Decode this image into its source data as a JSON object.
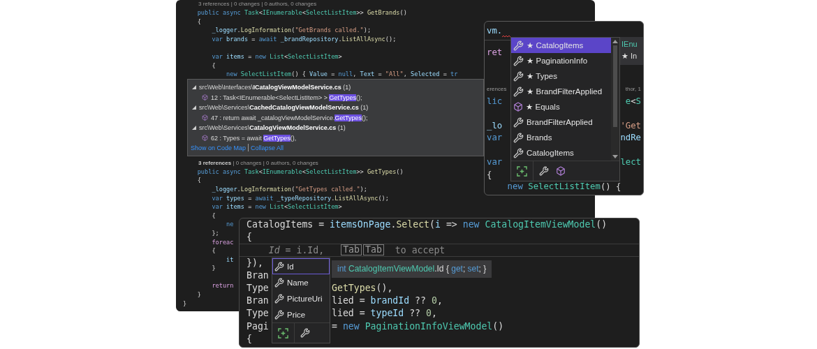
{
  "main_editor": {
    "lines": [
      {
        "kind": "codelens",
        "text": "3 references | 0 changes | 0 authors, 0 changes"
      },
      {
        "kind": "code",
        "tokens": [
          {
            "text": "    public async ",
            "kind": "kw"
          },
          {
            "text": "Task",
            "kind": "type"
          },
          {
            "text": "<",
            "kind": "plain"
          },
          {
            "text": "IEnumerable",
            "kind": "type"
          },
          {
            "text": "<",
            "kind": "plain"
          },
          {
            "text": "SelectListItem",
            "kind": "type"
          },
          {
            "text": ">> ",
            "kind": "plain"
          },
          {
            "text": "GetBrands",
            "kind": "method"
          },
          {
            "text": "()",
            "kind": "plain"
          }
        ]
      },
      {
        "kind": "code",
        "tokens": [
          {
            "text": "    {",
            "kind": "plain"
          }
        ]
      },
      {
        "kind": "code",
        "tokens": [
          {
            "text": "        _logger",
            "kind": "var"
          },
          {
            "text": ".",
            "kind": "plain"
          },
          {
            "text": "LogInformation",
            "kind": "method"
          },
          {
            "text": "(",
            "kind": "plain"
          },
          {
            "text": "\"GetBrands called.\"",
            "kind": "str"
          },
          {
            "text": ");",
            "kind": "plain"
          }
        ]
      },
      {
        "kind": "code",
        "tokens": [
          {
            "text": "        var ",
            "kind": "kw"
          },
          {
            "text": "brands",
            "kind": "var"
          },
          {
            "text": " = ",
            "kind": "plain"
          },
          {
            "text": "await ",
            "kind": "kw"
          },
          {
            "text": "_brandRepository",
            "kind": "var"
          },
          {
            "text": ".",
            "kind": "plain"
          },
          {
            "text": "ListAllAsync",
            "kind": "method"
          },
          {
            "text": "();",
            "kind": "plain"
          }
        ]
      },
      {
        "kind": "blank"
      },
      {
        "kind": "code",
        "tokens": [
          {
            "text": "        var ",
            "kind": "kw"
          },
          {
            "text": "items",
            "kind": "var"
          },
          {
            "text": " = ",
            "kind": "plain"
          },
          {
            "text": "new ",
            "kind": "kw"
          },
          {
            "text": "List",
            "kind": "type"
          },
          {
            "text": "<",
            "kind": "plain"
          },
          {
            "text": "SelectListItem",
            "kind": "type"
          },
          {
            "text": ">",
            "kind": "plain"
          }
        ]
      },
      {
        "kind": "code",
        "tokens": [
          {
            "text": "        {",
            "kind": "plain"
          }
        ]
      },
      {
        "kind": "code",
        "tokens": [
          {
            "text": "            new ",
            "kind": "kw"
          },
          {
            "text": "SelectListItem",
            "kind": "type"
          },
          {
            "text": "() { ",
            "kind": "plain"
          },
          {
            "text": "Value",
            "kind": "var"
          },
          {
            "text": " = ",
            "kind": "plain"
          },
          {
            "text": "null",
            "kind": "kw"
          },
          {
            "text": ", ",
            "kind": "plain"
          },
          {
            "text": "Text",
            "kind": "var"
          },
          {
            "text": " = ",
            "kind": "plain"
          },
          {
            "text": "\"All\"",
            "kind": "str"
          },
          {
            "text": ", ",
            "kind": "plain"
          },
          {
            "text": "Selected",
            "kind": "var"
          },
          {
            "text": " = ",
            "kind": "plain"
          },
          {
            "text": "tr",
            "kind": "kw"
          }
        ]
      },
      {
        "kind": "references_popup",
        "rows": [
          {
            "kind": "file",
            "folder": "src\\Web\\Interfaces\\",
            "file": "ICatalogViewModelService.cs",
            "count": "(1)",
            "expanded": true
          },
          {
            "kind": "reference",
            "before": "12 : Task<IEnumerable<SelectListItem> > ",
            "match": "GetTypes",
            "after": "();"
          },
          {
            "kind": "file",
            "folder": "src\\Web\\Services\\",
            "file": "CachedCatalogViewModelService.cs",
            "count": "(1)",
            "expanded": true
          },
          {
            "kind": "reference",
            "before": "47 : return await _catalogViewModelService.",
            "match": "GetTypes",
            "after": "();"
          },
          {
            "kind": "file",
            "folder": "src\\Web\\Services\\",
            "file": "CatalogViewModelService.cs",
            "count": "(1)",
            "expanded": true
          },
          {
            "kind": "reference",
            "before": "62 : Types = await ",
            "match": "GetTypes",
            "after": "(),"
          }
        ],
        "links": [
          "Show on Code Map",
          "Collapse All"
        ]
      },
      {
        "kind": "codelens",
        "text": "**3 references** | 0 changes | 0 authors, 0 changes"
      },
      {
        "kind": "code",
        "tokens": [
          {
            "text": "    public async ",
            "kind": "kw"
          },
          {
            "text": "Task",
            "kind": "type"
          },
          {
            "text": "<",
            "kind": "plain"
          },
          {
            "text": "IEnumerable",
            "kind": "type"
          },
          {
            "text": "<",
            "kind": "plain"
          },
          {
            "text": "SelectListItem",
            "kind": "type"
          },
          {
            "text": ">> ",
            "kind": "plain"
          },
          {
            "text": "GetTypes",
            "kind": "method"
          },
          {
            "text": "()",
            "kind": "plain"
          }
        ]
      },
      {
        "kind": "code",
        "tokens": [
          {
            "text": "    {",
            "kind": "plain"
          }
        ]
      },
      {
        "kind": "code",
        "tokens": [
          {
            "text": "        _logger",
            "kind": "var"
          },
          {
            "text": ".",
            "kind": "plain"
          },
          {
            "text": "LogInformation",
            "kind": "method"
          },
          {
            "text": "(",
            "kind": "plain"
          },
          {
            "text": "\"GetTypes called.\"",
            "kind": "str"
          },
          {
            "text": ");",
            "kind": "plain"
          }
        ]
      },
      {
        "kind": "code",
        "tokens": [
          {
            "text": "        var ",
            "kind": "kw"
          },
          {
            "text": "types",
            "kind": "var"
          },
          {
            "text": " = ",
            "kind": "plain"
          },
          {
            "text": "await ",
            "kind": "kw"
          },
          {
            "text": "_typeRepository",
            "kind": "var"
          },
          {
            "text": ".",
            "kind": "plain"
          },
          {
            "text": "ListAllAsync",
            "kind": "method"
          },
          {
            "text": "();",
            "kind": "plain"
          }
        ]
      },
      {
        "kind": "code",
        "tokens": [
          {
            "text": "        var ",
            "kind": "kw"
          },
          {
            "text": "items",
            "kind": "var"
          },
          {
            "text": " = ",
            "kind": "plain"
          },
          {
            "text": "new ",
            "kind": "kw"
          },
          {
            "text": "List",
            "kind": "type"
          },
          {
            "text": "<",
            "kind": "plain"
          },
          {
            "text": "SelectListItem",
            "kind": "type"
          },
          {
            "text": ">",
            "kind": "plain"
          }
        ]
      },
      {
        "kind": "code",
        "tokens": [
          {
            "text": "        {",
            "kind": "plain"
          }
        ]
      },
      {
        "kind": "code",
        "tokens": [
          {
            "text": "            ne",
            "kind": "kw"
          }
        ]
      },
      {
        "kind": "code",
        "tokens": [
          {
            "text": "        };",
            "kind": "plain"
          }
        ]
      },
      {
        "kind": "code",
        "tokens": [
          {
            "text": "        foreac",
            "kind": "ctl"
          }
        ]
      },
      {
        "kind": "code",
        "tokens": [
          {
            "text": "        {",
            "kind": "plain"
          }
        ]
      },
      {
        "kind": "code",
        "tokens": [
          {
            "text": "            it",
            "kind": "var"
          }
        ]
      },
      {
        "kind": "code",
        "tokens": [
          {
            "text": "        }",
            "kind": "plain"
          }
        ]
      },
      {
        "kind": "blank"
      },
      {
        "kind": "code",
        "tokens": [
          {
            "text": "        return",
            "kind": "ctl"
          }
        ]
      },
      {
        "kind": "code",
        "tokens": [
          {
            "text": "    }",
            "kind": "plain"
          }
        ]
      },
      {
        "kind": "code",
        "tokens": [
          {
            "text": "}",
            "kind": "plain"
          }
        ]
      }
    ]
  },
  "member_list_editor": {
    "header": [
      {
        "text": "vm.",
        "kind": "var"
      }
    ],
    "rows": [
      {
        "left": [
          {
            "text": "ret",
            "kind": "ctl"
          }
        ]
      },
      {
        "kind": "blank"
      },
      {
        "kind": "blank"
      },
      {
        "kind": "codelens",
        "left": [
          {
            "text": "erences",
            "kind": "codelens"
          }
        ],
        "right": [
          {
            "text": "thor, 1",
            "kind": "codelens"
          }
        ]
      },
      {
        "left": [
          {
            "text": "lic",
            "kind": "kw"
          }
        ],
        "right": [
          {
            "text": "e",
            "kind": "type"
          },
          {
            "text": "<",
            "kind": "plain"
          },
          {
            "text": "S",
            "kind": "type"
          }
        ]
      },
      {
        "kind": "blank"
      },
      {
        "left": [
          {
            "text": "_lo",
            "kind": "var"
          }
        ],
        "right": [
          {
            "text": "'Get",
            "kind": "str"
          }
        ]
      },
      {
        "left": [
          {
            "text": "var",
            "kind": "kw"
          }
        ],
        "right": [
          {
            "text": "ndRe",
            "kind": "var"
          }
        ]
      },
      {
        "kind": "blank"
      },
      {
        "left": [
          {
            "text": "var",
            "kind": "kw"
          }
        ],
        "right": [
          {
            "text": "lect",
            "kind": "type"
          }
        ]
      },
      {
        "left": [
          {
            "text": "{",
            "kind": "plain"
          }
        ]
      },
      {
        "left": [
          {
            "text": "    new ",
            "kind": "kw"
          },
          {
            "text": "SelectListItem",
            "kind": "type"
          },
          {
            "text": "() {",
            "kind": "plain"
          }
        ]
      }
    ],
    "completion": {
      "items": [
        {
          "label": "★ CatalogItems",
          "kind": "property",
          "selected": true
        },
        {
          "label": "★ PaginationInfo",
          "kind": "property",
          "selected": false
        },
        {
          "label": "★ Types",
          "kind": "property",
          "selected": false
        },
        {
          "label": "★ BrandFilterApplied",
          "kind": "property",
          "selected": false
        },
        {
          "label": "★ Equals",
          "kind": "method",
          "selected": false
        },
        {
          "label": "BrandFilterApplied",
          "kind": "property",
          "selected": false
        },
        {
          "label": "Brands",
          "kind": "property",
          "selected": false
        },
        {
          "label": "CatalogItems",
          "kind": "property",
          "selected": false
        }
      ]
    },
    "tooltip": [
      {
        "text": "IEnu",
        "kind": "type"
      },
      {
        "text": "★ In",
        "kind": "plain"
      }
    ]
  },
  "inline_suggestion_editor": {
    "rows": [
      {
        "full": [
          {
            "text": "CatalogItems",
            "kind": "plain"
          },
          {
            "text": " = ",
            "kind": "plain"
          },
          {
            "text": "itemsOnPage",
            "kind": "var"
          },
          {
            "text": ".",
            "kind": "plain"
          },
          {
            "text": "Select",
            "kind": "method"
          },
          {
            "text": "(",
            "kind": "plain"
          },
          {
            "text": "i",
            "kind": "var"
          },
          {
            "text": " => ",
            "kind": "plain"
          },
          {
            "text": "new ",
            "kind": "kw"
          },
          {
            "text": "CatalogItemViewModel",
            "kind": "type"
          },
          {
            "text": "()",
            "kind": "plain"
          }
        ]
      },
      {
        "full": [
          {
            "text": "{",
            "kind": "plain"
          }
        ]
      },
      {
        "kind": "ghost",
        "suggestion": "*Id* = i.Id,",
        "keys": [
          "Tab",
          "Tab"
        ],
        "hint": "to accept"
      },
      {
        "full": [
          {
            "text": "}),",
            "kind": "plain"
          }
        ]
      },
      {
        "left": [
          {
            "text": "Bran",
            "kind": "plain"
          }
        ]
      },
      {
        "left": [
          {
            "text": "Type",
            "kind": "plain"
          }
        ],
        "right": [
          {
            "text": "GetTypes",
            "kind": "method"
          },
          {
            "text": "(),",
            "kind": "plain"
          }
        ]
      },
      {
        "left": [
          {
            "text": "Bran",
            "kind": "plain"
          }
        ],
        "right": [
          {
            "text": "lied = ",
            "kind": "plain"
          },
          {
            "text": "brandId",
            "kind": "var"
          },
          {
            "text": " ?? ",
            "kind": "plain"
          },
          {
            "text": "0",
            "kind": "num"
          },
          {
            "text": ",",
            "kind": "plain"
          }
        ]
      },
      {
        "left": [
          {
            "text": "Type",
            "kind": "plain"
          }
        ],
        "right": [
          {
            "text": "lied = ",
            "kind": "plain"
          },
          {
            "text": "typeId",
            "kind": "var"
          },
          {
            "text": " ?? ",
            "kind": "plain"
          },
          {
            "text": "0",
            "kind": "num"
          },
          {
            "text": ",",
            "kind": "plain"
          }
        ]
      },
      {
        "left": [
          {
            "text": "Pagi",
            "kind": "plain"
          }
        ],
        "right": [
          {
            "text": "= ",
            "kind": "plain"
          },
          {
            "text": "new ",
            "kind": "kw"
          },
          {
            "text": "PaginationInfoViewModel",
            "kind": "type"
          },
          {
            "text": "()",
            "kind": "plain"
          }
        ]
      },
      {
        "full": [
          {
            "text": "{",
            "kind": "plain"
          }
        ]
      }
    ],
    "completion": {
      "items": [
        {
          "label": "Id",
          "kind": "property",
          "selected": true
        },
        {
          "label": "Name",
          "kind": "property",
          "selected": false
        },
        {
          "label": "PictureUri",
          "kind": "property",
          "selected": false
        },
        {
          "label": "Price",
          "kind": "property",
          "selected": false
        }
      ]
    },
    "tooltip": [
      {
        "text": "int ",
        "kind": "kw"
      },
      {
        "text": "CatalogItemViewModel",
        "kind": "type"
      },
      {
        "text": ".Id ",
        "kind": "plain"
      },
      {
        "text": "{ ",
        "kind": "plain"
      },
      {
        "text": "get",
        "kind": "kw"
      },
      {
        "text": "; ",
        "kind": "plain"
      },
      {
        "text": "set",
        "kind": "kw"
      },
      {
        "text": "; }",
        "kind": "plain"
      }
    ]
  }
}
